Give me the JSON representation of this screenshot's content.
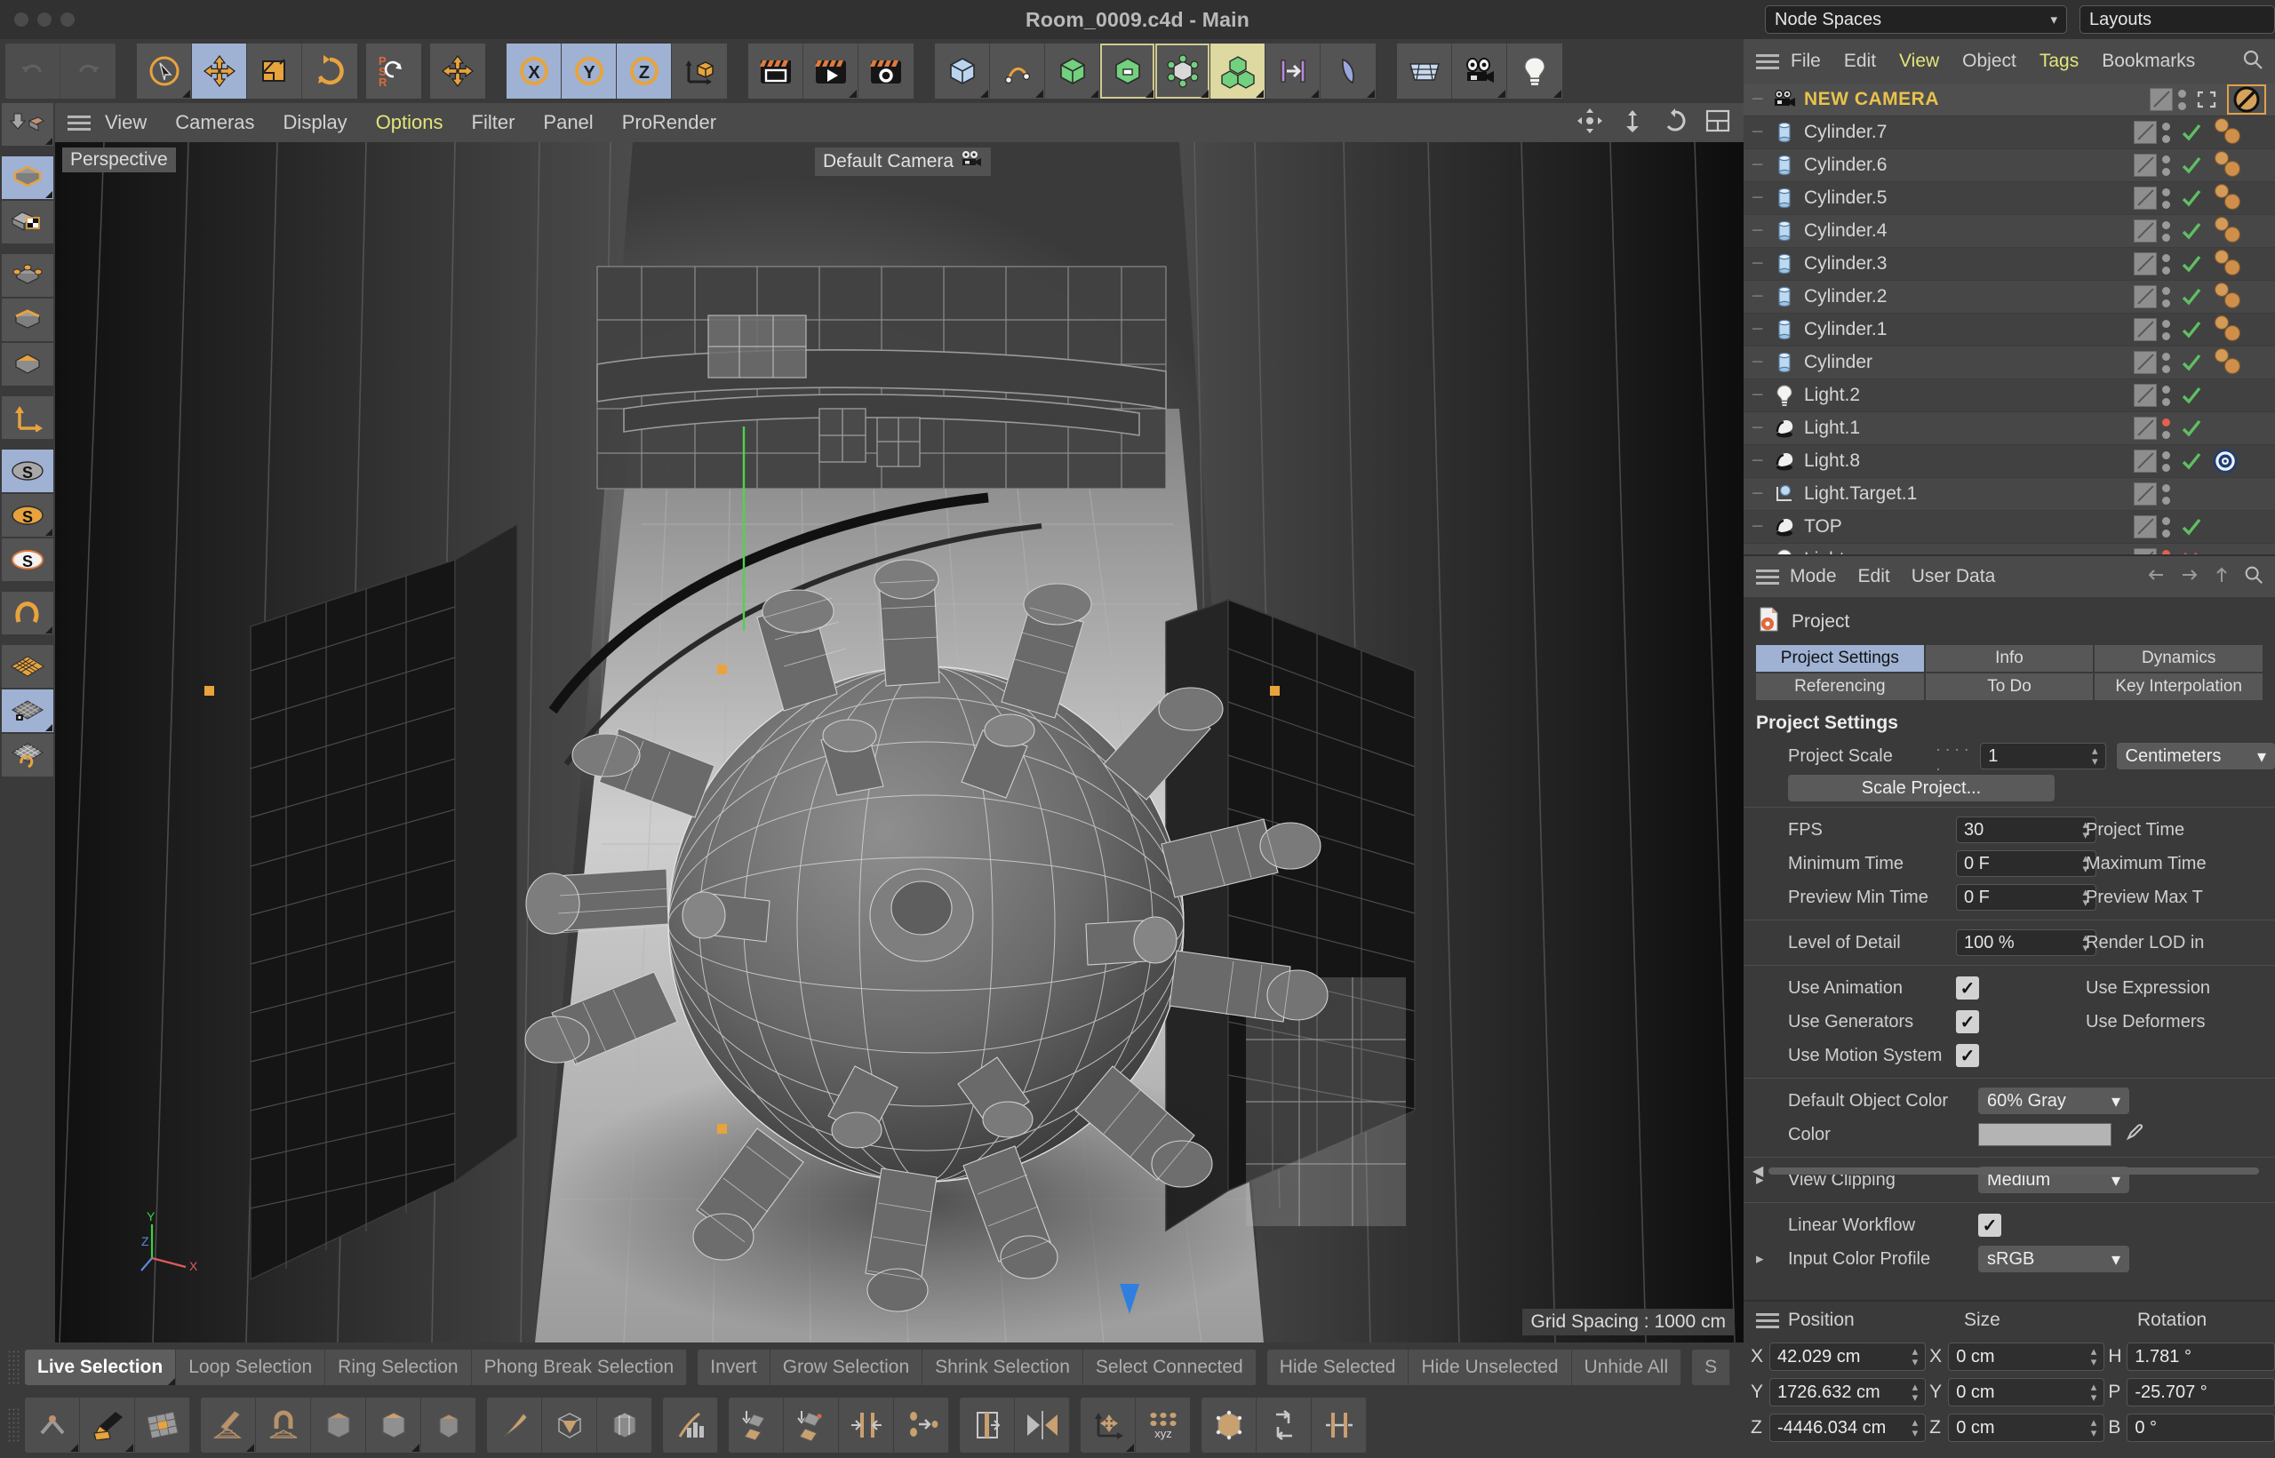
{
  "window": {
    "title": "Room_0009.c4d - Main",
    "node_spaces_label": "Node Spaces",
    "layouts_label": "Layouts"
  },
  "viewport": {
    "menu": [
      "View",
      "Cameras",
      "Display",
      "Options",
      "Filter",
      "Panel",
      "ProRender"
    ],
    "highlight_menu": "Options",
    "projection_label": "Perspective",
    "camera_label": "Default Camera",
    "grid_spacing_label": "Grid Spacing : 1000 cm",
    "axis_labels": {
      "x": "X",
      "y": "Y",
      "z": "Z"
    }
  },
  "object_manager": {
    "menu": [
      "File",
      "Edit",
      "View",
      "Object",
      "Tags",
      "Bookmarks"
    ],
    "highlight_menu": [
      "View",
      "Tags"
    ],
    "items": [
      {
        "name": "NEW CAMERA",
        "icon": "camera-icon",
        "selected": true,
        "state": "frame",
        "tags": "disabled-tag"
      },
      {
        "name": "Cylinder.7",
        "icon": "cylinder-icon",
        "selected": false,
        "state": "check",
        "tags": "material-tags"
      },
      {
        "name": "Cylinder.6",
        "icon": "cylinder-icon",
        "selected": false,
        "state": "check",
        "tags": "material-tags"
      },
      {
        "name": "Cylinder.5",
        "icon": "cylinder-icon",
        "selected": false,
        "state": "check",
        "tags": "material-tags"
      },
      {
        "name": "Cylinder.4",
        "icon": "cylinder-icon",
        "selected": false,
        "state": "check",
        "tags": "material-tags"
      },
      {
        "name": "Cylinder.3",
        "icon": "cylinder-icon",
        "selected": false,
        "state": "check",
        "tags": "material-tags"
      },
      {
        "name": "Cylinder.2",
        "icon": "cylinder-icon",
        "selected": false,
        "state": "check",
        "tags": "material-tags"
      },
      {
        "name": "Cylinder.1",
        "icon": "cylinder-icon",
        "selected": false,
        "state": "check",
        "tags": "material-tags"
      },
      {
        "name": "Cylinder",
        "icon": "cylinder-icon",
        "selected": false,
        "state": "check",
        "tags": "material-tags"
      },
      {
        "name": "Light.2",
        "icon": "light-bulb-icon",
        "selected": false,
        "state": "check",
        "tags": "none"
      },
      {
        "name": "Light.1",
        "icon": "spot-light-icon",
        "selected": false,
        "state": "check-red",
        "tags": "none"
      },
      {
        "name": "Light.8",
        "icon": "spot-light-icon",
        "selected": false,
        "state": "check",
        "tags": "target-tag"
      },
      {
        "name": "Light.Target.1",
        "icon": "null-target-icon",
        "selected": false,
        "state": "none",
        "tags": "none"
      },
      {
        "name": "TOP",
        "icon": "spot-light-icon",
        "selected": false,
        "state": "check",
        "tags": "none"
      },
      {
        "name": "Light",
        "icon": "light-bulb-icon",
        "selected": false,
        "state": "cross-red",
        "tags": "none"
      }
    ]
  },
  "attributes": {
    "menu": [
      "Mode",
      "Edit",
      "User Data"
    ],
    "object_title": "Project",
    "tabs_row1": [
      "Project Settings",
      "Info",
      "Dynamics"
    ],
    "tabs_row2": [
      "Referencing",
      "To Do",
      "Key Interpolation"
    ],
    "active_tab": "Project Settings",
    "section_title": "Project Settings",
    "fields": {
      "project_scale_label": "Project Scale",
      "project_scale_value": "1",
      "project_units_value": "Centimeters",
      "scale_project_button": "Scale Project...",
      "fps_label": "FPS",
      "fps_value": "30",
      "project_time_label": "Project Time",
      "minimum_time_label": "Minimum Time",
      "minimum_time_value": "0 F",
      "maximum_time_label": "Maximum Time",
      "preview_min_label": "Preview Min Time",
      "preview_min_value": "0 F",
      "preview_max_label": "Preview Max T",
      "lod_label": "Level of Detail",
      "lod_value": "100 %",
      "render_lod_label": "Render LOD in",
      "use_animation_label": "Use Animation",
      "use_animation_checked": true,
      "use_expressions_label": "Use Expression",
      "use_generators_label": "Use Generators",
      "use_generators_checked": true,
      "use_deformers_label": "Use Deformers",
      "use_motion_label": "Use Motion System",
      "use_motion_checked": true,
      "default_object_color_label": "Default Object Color",
      "default_object_color_value": "60% Gray",
      "color_label": "Color",
      "color_swatch": "#b4b4b4",
      "view_clipping_label": "View Clipping",
      "view_clipping_value": "Medium",
      "linear_workflow_label": "Linear Workflow",
      "linear_workflow_checked": true,
      "input_color_profile_label": "Input Color Profile",
      "input_color_profile_value": "sRGB"
    }
  },
  "coordinates": {
    "headers": {
      "position": "Position",
      "size": "Size",
      "rotation": "Rotation"
    },
    "rows": [
      {
        "pos_axis": "X",
        "pos_value": "42.029 cm",
        "size_axis": "X",
        "size_value": "0 cm",
        "rot_axis": "H",
        "rot_value": "1.781 °"
      },
      {
        "pos_axis": "Y",
        "pos_value": "1726.632 cm",
        "size_axis": "Y",
        "size_value": "0 cm",
        "rot_axis": "P",
        "rot_value": "-25.707 °"
      },
      {
        "pos_axis": "Z",
        "pos_value": "-4446.034 cm",
        "size_axis": "Z",
        "size_value": "0 cm",
        "rot_axis": "B",
        "rot_value": "0 °"
      }
    ]
  },
  "selection_bar": {
    "group1": [
      "Live Selection",
      "Loop Selection",
      "Ring Selection",
      "Phong Break Selection"
    ],
    "group2": [
      "Invert",
      "Grow Selection",
      "Shrink Selection",
      "Select Connected"
    ],
    "group3": [
      "Hide Selected",
      "Hide Unselected",
      "Unhide All"
    ],
    "group4": [
      "S"
    ],
    "active": "Live Selection"
  },
  "toolbar": {
    "undo": "undo-icon",
    "redo": "redo-icon",
    "tools": [
      "live-selection-icon",
      "move-icon",
      "scale-icon",
      "rotate-icon",
      "psr-icon",
      "world-axis-icon"
    ],
    "axis_locks": [
      "X",
      "Y",
      "Z"
    ],
    "render_tools": [
      "render-view-icon",
      "render-queue-icon",
      "render-settings-icon"
    ],
    "mode_tools": [
      "primitive-icon",
      "spline-icon",
      "generator-icon",
      "deformer-icon",
      "environment-icon",
      "scene-icon",
      "camera-icon",
      "light-icon"
    ],
    "active_move": true,
    "active_axes": [
      "X",
      "Y",
      "Z"
    ]
  },
  "colors": {
    "accent_orange": "#e8a33d",
    "selection_blue": "#9fb2d4",
    "highlight_yellow": "#e4e47a",
    "panel_bg": "#3a3a3a",
    "button_bg": "#545454",
    "camera_label": "#e8c24b"
  }
}
